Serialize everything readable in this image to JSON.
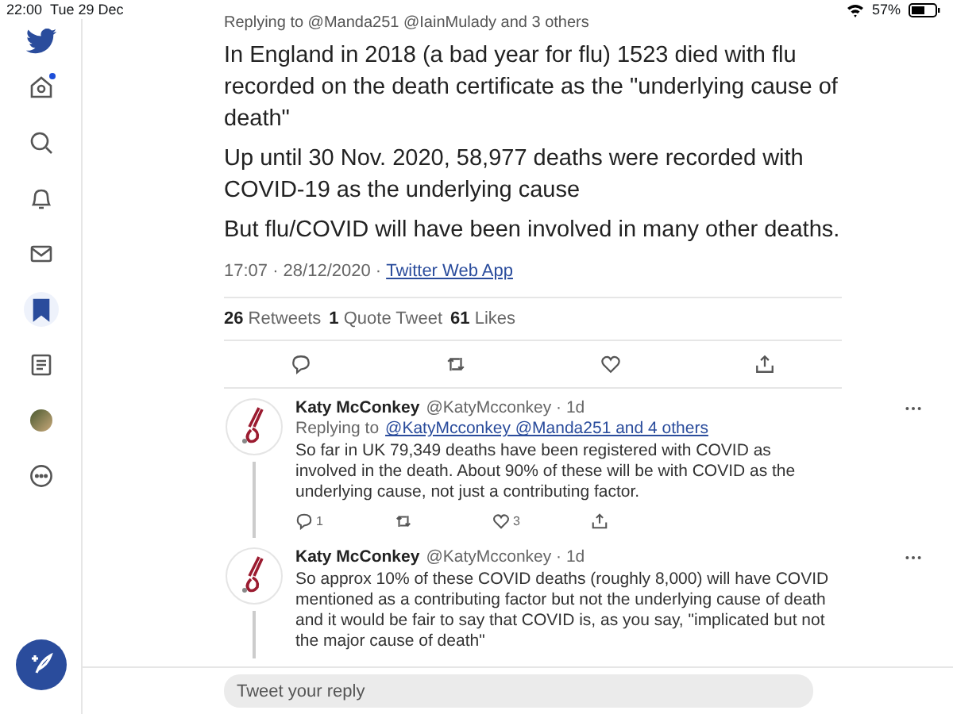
{
  "status_bar": {
    "time": "22:00",
    "date": "Tue 29 Dec",
    "battery": "57%"
  },
  "sidebar": {
    "items": [
      {
        "kind": "home",
        "selected": false,
        "badge": true
      },
      {
        "kind": "search",
        "selected": false,
        "badge": false
      },
      {
        "kind": "bell",
        "selected": false,
        "badge": false
      },
      {
        "kind": "mail",
        "selected": false,
        "badge": false
      },
      {
        "kind": "bookmark",
        "selected": true,
        "badge": false
      },
      {
        "kind": "list",
        "selected": false,
        "badge": false
      },
      {
        "kind": "avatar",
        "selected": false,
        "badge": false
      },
      {
        "kind": "more",
        "selected": false,
        "badge": false
      }
    ]
  },
  "tweet": {
    "replying_to": "Replying to @Manda251 @IainMulady and 3 others",
    "paragraphs": [
      "In England in 2018 (a bad year for flu) 1523 died with flu recorded on the death certificate as the \"underlying cause of death\"",
      "Up until 30 Nov. 2020, 58,977 deaths were recorded with COVID-19 as the underlying cause",
      "But flu/COVID will have been involved in many other deaths."
    ],
    "time": "17:07 · 28/12/2020 ·",
    "source": "Twitter Web App",
    "stats": [
      {
        "count": "26",
        "label": "Retweets"
      },
      {
        "count": "1",
        "label": "Quote Tweet"
      },
      {
        "count": "61",
        "label": "Likes"
      }
    ]
  },
  "replies": [
    {
      "name": "Katy McConkey",
      "handle": "@KatyMcconkey · 1d",
      "replying_to": "Replying to",
      "mentions": "@KatyMcconkey @Manda251 and 4 others",
      "text": "So far in UK 79,349 deaths have been registered with COVID as involved in the death. About 90% of these will be with COVID as the underlying cause, not just a contributing factor.",
      "replies_count": "1",
      "likes_count": "3"
    },
    {
      "name": "Katy McConkey",
      "handle": "@KatyMcconkey · 1d",
      "text": "So approx 10% of these COVID deaths  (roughly 8,000) will have COVID mentioned as a contributing factor but not the underlying cause of death and it would be fair to say that COVID is, as you say, \"implicated but not the major cause of death\""
    }
  ],
  "reply_box": {
    "placeholder": "Tweet your reply"
  }
}
